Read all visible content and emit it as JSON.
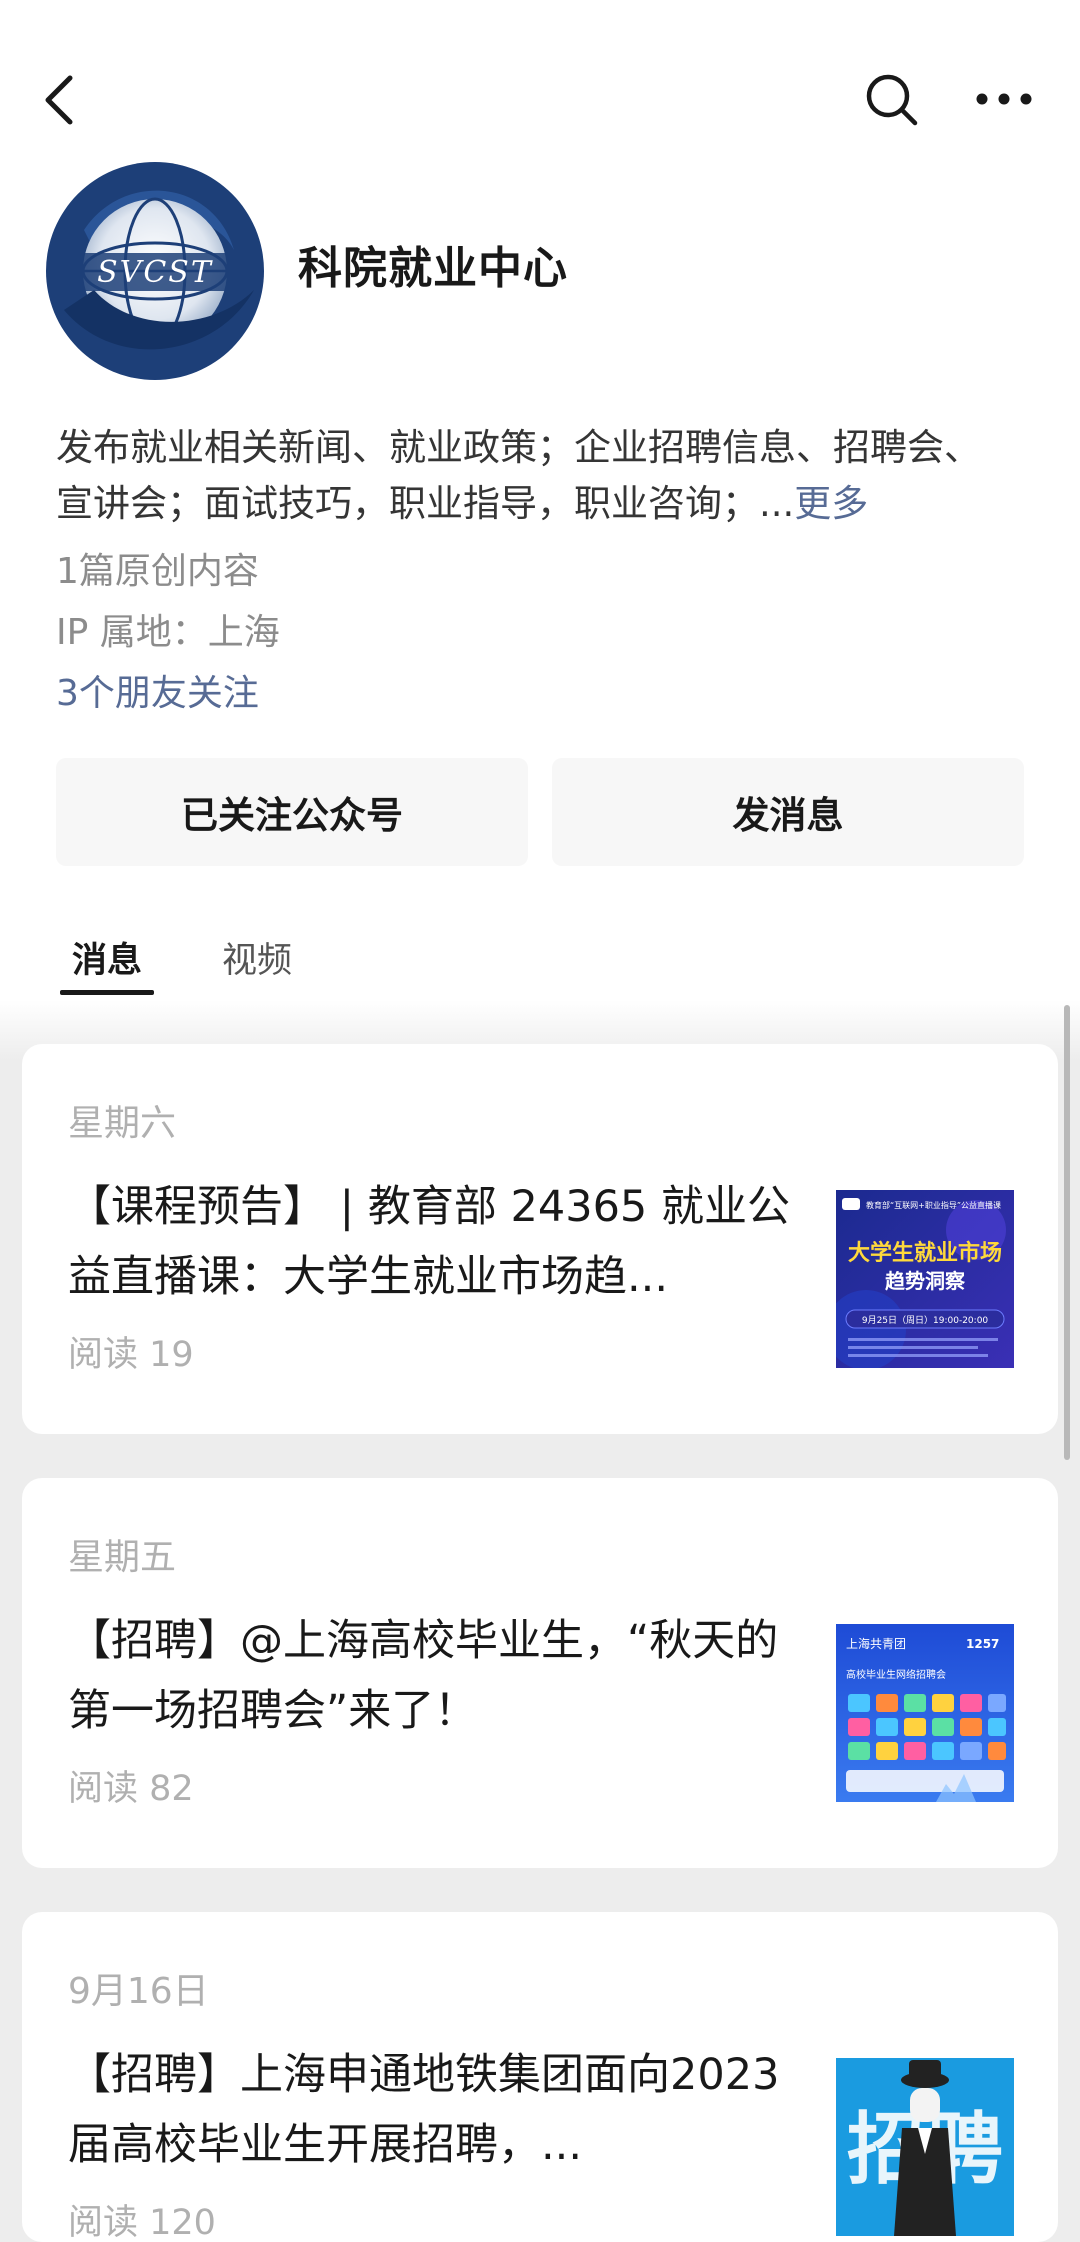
{
  "account": {
    "name": "科院就业中心",
    "logo_text": "SVCST",
    "description": "发布就业相关新闻、就业政策；企业招聘信息、招聘会、宣讲会；面试技巧，职业指导，职业咨询；...",
    "more_label": "更多",
    "original_count": "1篇原创内容",
    "ip_location": "IP 属地：上海",
    "friends_following": "3个朋友关注"
  },
  "buttons": {
    "followed": "已关注公众号",
    "message": "发消息"
  },
  "tabs": [
    {
      "label": "消息",
      "active": true
    },
    {
      "label": "视频",
      "active": false
    }
  ],
  "articles": [
    {
      "date": "星期六",
      "title": "【课程预告】 | 教育部 24365 就业公益直播课：大学生就业市场趋...",
      "reads": "阅读 19",
      "thumb": {
        "header_text": "教育部“互联网+职业指导”公益直播课",
        "main_text_1": "大学生就业市场",
        "main_text_2": "趋势洞察",
        "date_text": "9月25日（周日）19:00-20:00",
        "colors": [
          "#1b2a8f",
          "#3a2fb5",
          "#ffd93b",
          "#ffffff"
        ]
      }
    },
    {
      "date": "星期五",
      "title": "【招聘】@上海高校毕业生，“秋天的第一场招聘会”来了！",
      "reads": "阅读 82",
      "thumb": {
        "header_text": "上海共青团",
        "number_text": "1257",
        "sub_text": "高校毕业生网络招聘会",
        "colors": [
          "#1e4bd6",
          "#3a7bf0",
          "#ffffff"
        ]
      }
    },
    {
      "date": "9月16日",
      "title": "【招聘】上海申通地铁集团面向2023届高校毕业生开展招聘，...",
      "reads": "阅读 120",
      "thumb": {
        "big_text": "招聘",
        "colors": [
          "#1a9be0",
          "#ffffff",
          "#222222"
        ]
      }
    }
  ],
  "colors": {
    "link_blue": "#576b95",
    "background_grey": "#ededed",
    "logo_navy": "#1d3f78"
  }
}
